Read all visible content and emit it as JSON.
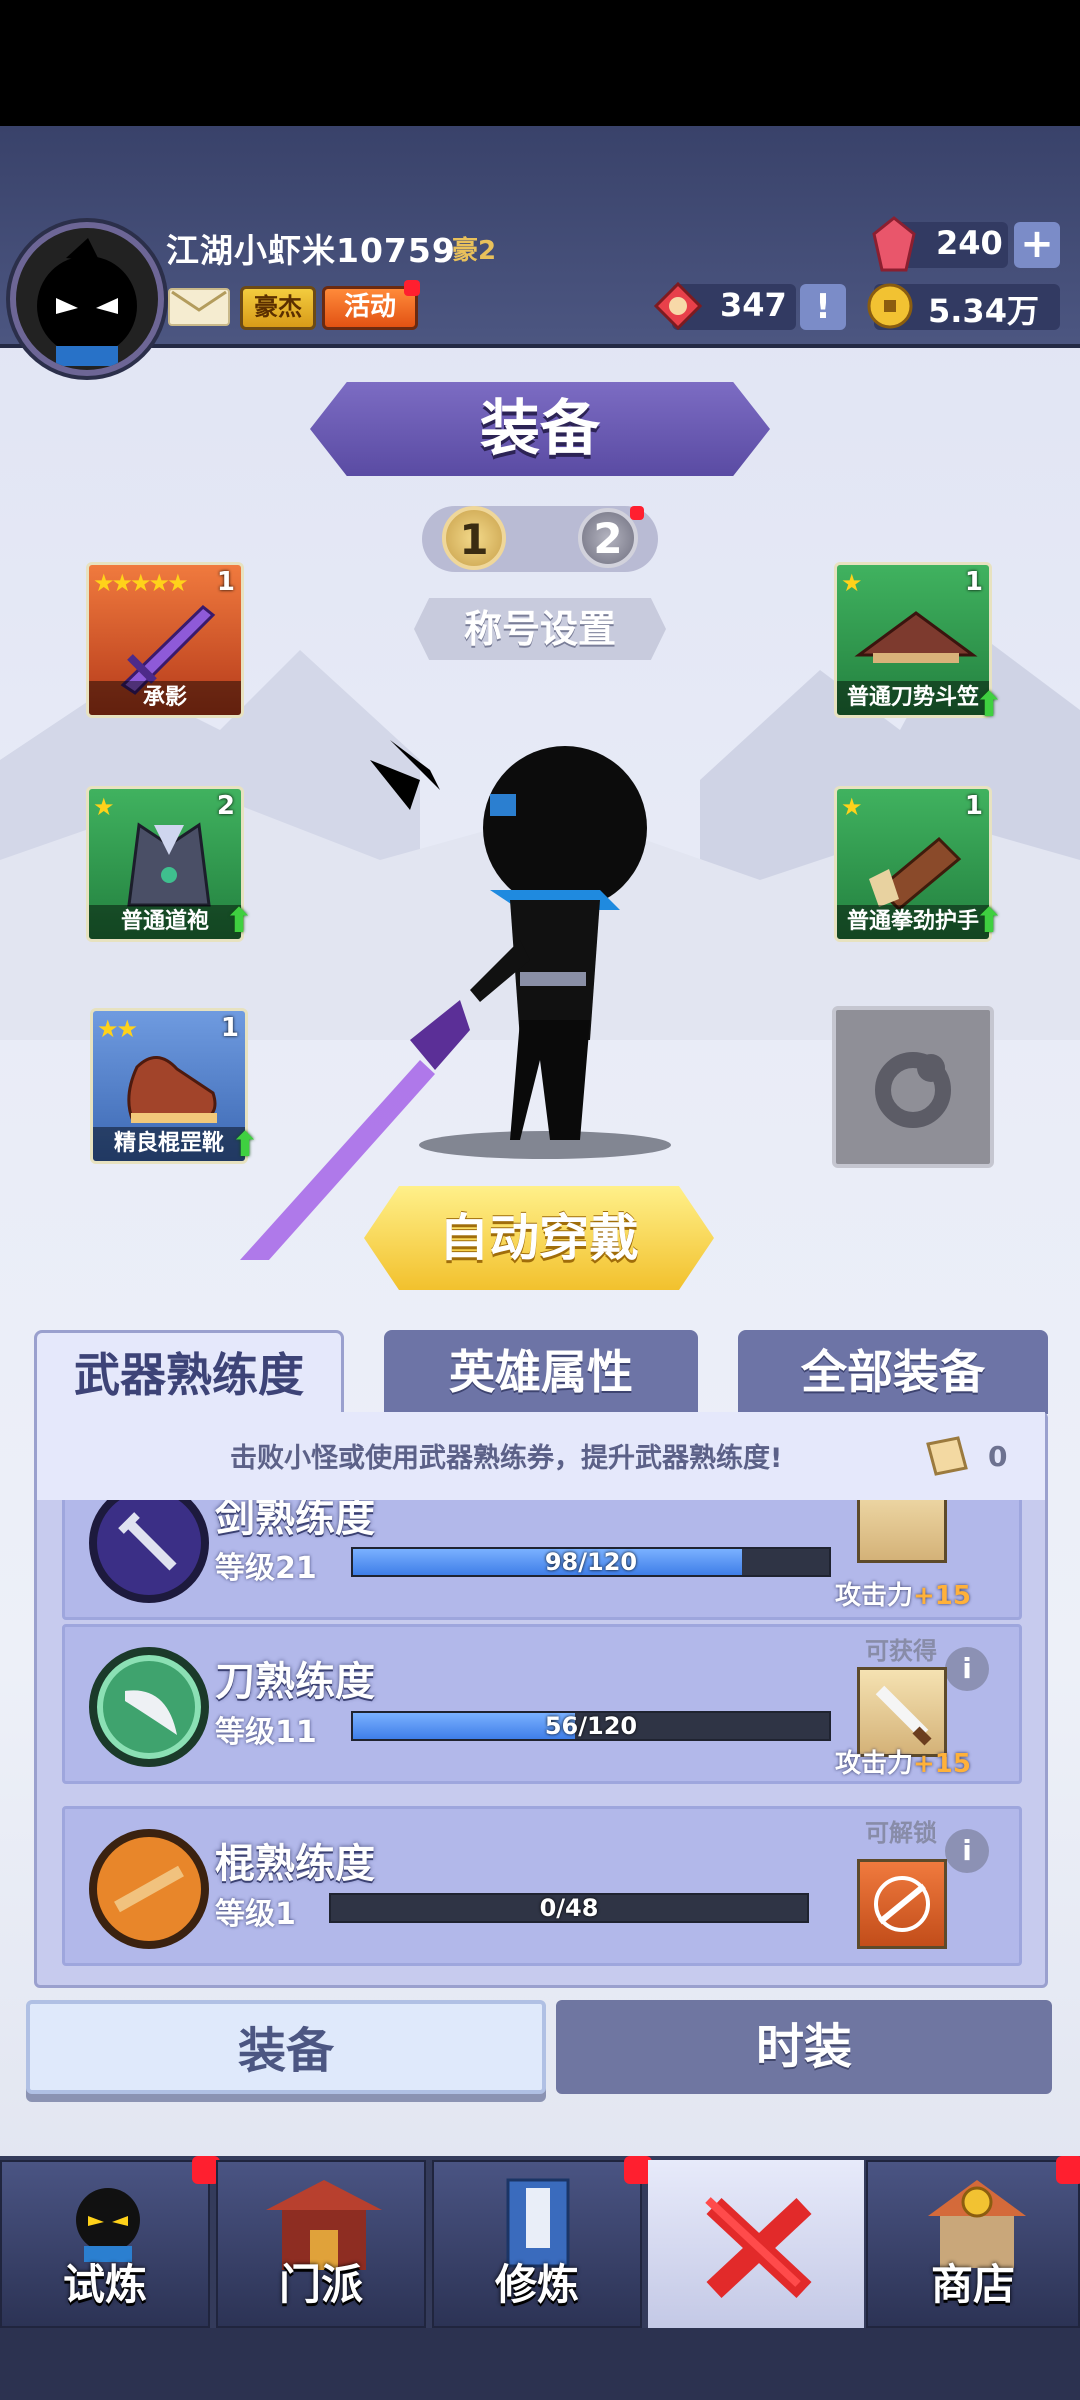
{
  "player": {
    "name": "江湖小虾米10759",
    "vip": "豪2",
    "hj_label": "豪杰",
    "activity_label": "活动"
  },
  "currency": {
    "gems": "240",
    "tokens": "347",
    "coins": "5.34万"
  },
  "page": {
    "title": "装备",
    "pages": [
      "1",
      "2"
    ],
    "title_setting": "称号设置",
    "auto_equip": "自动穿戴"
  },
  "slots": [
    {
      "label": "承影",
      "level": "1",
      "stars": 5,
      "color": "#d8572a"
    },
    {
      "label": "普通道袍",
      "level": "2",
      "stars": 1,
      "color": "#2f9a4f"
    },
    {
      "label": "精良棍罡靴",
      "level": "1",
      "stars": 2,
      "color": "#4a7bc4"
    },
    {
      "label": "普通刀势斗笠",
      "level": "1",
      "stars": 1,
      "color": "#2f9a4f"
    },
    {
      "label": "普通拳劲护手",
      "level": "1",
      "stars": 1,
      "color": "#2f9a4f"
    }
  ],
  "tabs": [
    "武器熟练度",
    "英雄属性",
    "全部装备"
  ],
  "hint": "击败小怪或使用武器熟练券，提升武器熟练度!",
  "book_count": "0",
  "proficiency": [
    {
      "title": "剑熟练度",
      "level": "等级21",
      "progress": "98/120",
      "ratio": 0.8167,
      "label": "",
      "reward": "攻击力",
      "bonus": "+15"
    },
    {
      "title": "刀熟练度",
      "level": "等级11",
      "progress": "56/120",
      "ratio": 0.4667,
      "label": "可获得",
      "reward": "攻击力",
      "bonus": "+15"
    },
    {
      "title": "棍熟练度",
      "level": "等级1",
      "progress": "0/48",
      "ratio": 0,
      "label": "可解锁",
      "reward": "",
      "bonus": ""
    }
  ],
  "subtabs": [
    "装备",
    "时装"
  ],
  "nav": [
    "试炼",
    "门派",
    "修炼",
    "",
    "商店"
  ],
  "colors": {
    "accent_purple": "#6a5bb3",
    "gold": "#f2c12d",
    "hud": "#3f4873"
  }
}
